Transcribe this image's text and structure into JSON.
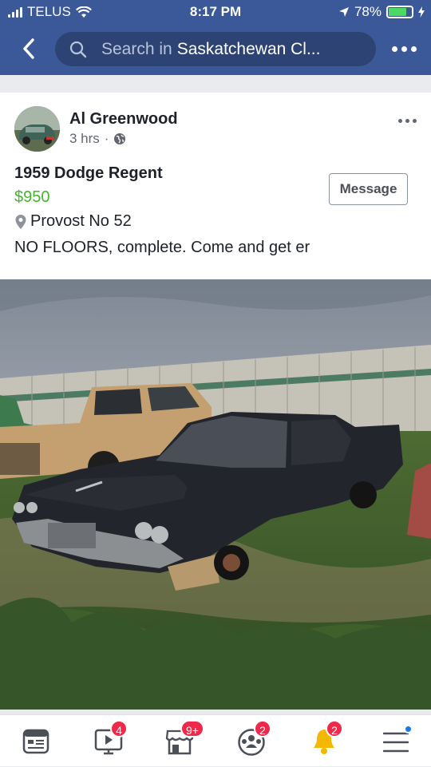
{
  "status_bar": {
    "carrier": "TELUS",
    "time": "8:17 PM",
    "battery": "78%"
  },
  "nav": {
    "search_prefix": "Search in",
    "search_context": "Saskatchewan Cl...",
    "back_icon": "chevron-left-icon",
    "more_icon": "more-dots-icon"
  },
  "post": {
    "author": "Al Greenwood",
    "time": "3 hrs",
    "privacy_icon": "globe-icon",
    "title": "1959 Dodge Regent",
    "price": "$950",
    "location": "Provost No 52",
    "description": "NO FLOORS, complete. Come and get er",
    "message_label": "Message"
  },
  "tabs": [
    {
      "icon": "news-feed-icon",
      "badge": ""
    },
    {
      "icon": "watch-icon",
      "badge": "4"
    },
    {
      "icon": "marketplace-icon",
      "badge": "9+"
    },
    {
      "icon": "groups-icon",
      "badge": "2"
    },
    {
      "icon": "notifications-bell-icon",
      "badge": "2"
    },
    {
      "icon": "menu-icon",
      "badge": ""
    }
  ],
  "colors": {
    "brand": "#3b5998",
    "price": "#42b72a",
    "badge": "#f02849"
  }
}
